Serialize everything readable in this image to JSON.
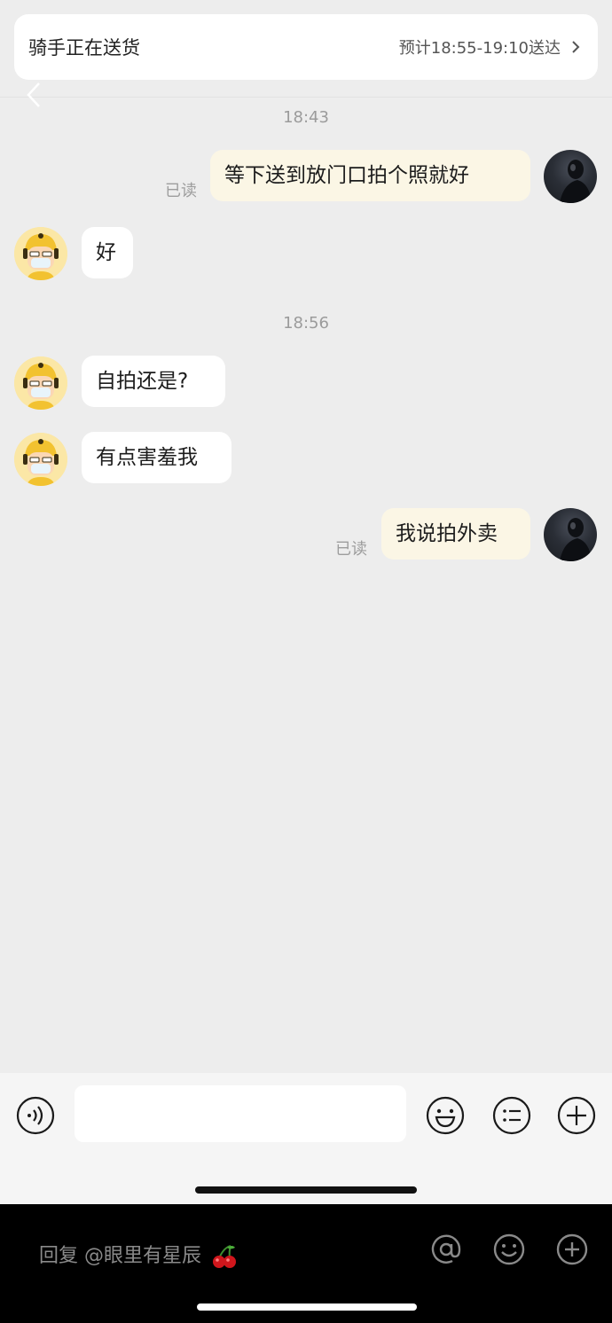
{
  "delivery_status": {
    "title": "骑手正在送货",
    "eta": "预计18:55-19:10送达"
  },
  "messages": {
    "t1": "18:43",
    "m1": {
      "text": "等下送到放门口拍个照就好",
      "read": "已读"
    },
    "m2": {
      "text": "好"
    },
    "t2": "18:56",
    "m3": {
      "text": "自拍还是?"
    },
    "m4": {
      "text": "有点害羞我"
    },
    "m5": {
      "text": "我说拍外卖",
      "read": "已读"
    }
  },
  "input": {
    "placeholder": ""
  },
  "reply_bar": {
    "text": "回复 @眼里有星辰"
  },
  "colors": {
    "background": "#ededed",
    "outgoing_bubble": "#fbf6e5",
    "incoming_bubble": "#ffffff",
    "rider_avatar": "#fbe7a6"
  }
}
